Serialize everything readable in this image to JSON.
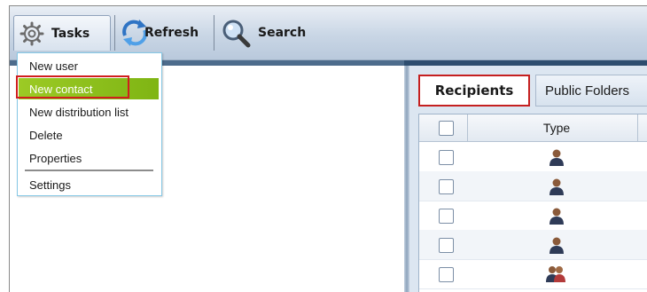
{
  "toolbar": {
    "tasks_label": "Tasks",
    "refresh_label": "Refresh",
    "search_label": "Search"
  },
  "tasks_menu": {
    "items": [
      {
        "label": "New user"
      },
      {
        "label": "New contact",
        "highlighted": true
      },
      {
        "label": "New distribution list"
      },
      {
        "label": "Delete"
      },
      {
        "label": "Properties"
      },
      {
        "label": "Settings"
      }
    ]
  },
  "tabs": [
    {
      "label": "Recipients",
      "active": true
    },
    {
      "label": "Public Folders",
      "active": false
    }
  ],
  "recipients_grid": {
    "columns": [
      "",
      "Type"
    ],
    "rows": [
      {
        "type_icon": "user-icon"
      },
      {
        "type_icon": "user-icon"
      },
      {
        "type_icon": "user-icon"
      },
      {
        "type_icon": "user-icon"
      },
      {
        "type_icon": "group-icon"
      }
    ]
  },
  "colors": {
    "highlight_border": "#d01e1e",
    "menu_highlight": "#8cbf1c",
    "dark_band": "#2d4d6f"
  }
}
